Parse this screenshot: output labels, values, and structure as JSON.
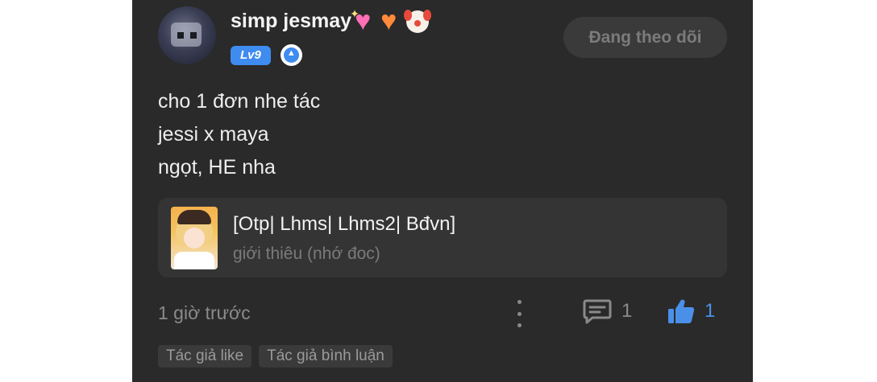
{
  "post": {
    "user": {
      "name": "simp jesmay",
      "emojis": [
        "sparkling-heart",
        "orange-heart",
        "clown-face"
      ],
      "level": "Lv9"
    },
    "follow_label": "Đang theo dõi",
    "content_lines": [
      "cho 1 đơn nhe tác",
      "jessi x maya",
      "ngọt, HE nha"
    ],
    "story": {
      "title": "[Otp| Lhms| Lhms2| Bđvn]",
      "subtitle": "giới thiêu (nhớ đoc)"
    },
    "time": "1 giờ trước",
    "comment_count": "1",
    "like_count": "1",
    "tags": [
      "Tác giả like",
      "Tác giả bình luận"
    ]
  },
  "colors": {
    "background": "#2a2a2a",
    "accent": "#3f8cf0",
    "like": "#4a90e8"
  }
}
